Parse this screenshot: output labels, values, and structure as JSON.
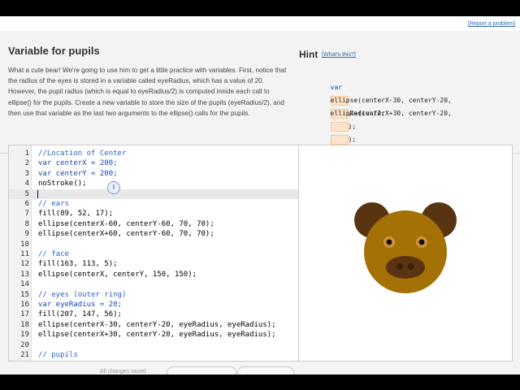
{
  "header": {
    "title": "Variable for pupils",
    "description": "What a cute bear! We're going to use him to get a little practice with variables. First, notice that the radius of the eyes is stored in a variable called eyeRadius, which has a value of 20. However, the pupil radius (which is equal to eyeRadius/2) is computed inside each call to ellipse() for the pupils. Create a new variable to store the size of the pupils (eyeRadius/2), and then use that variable as the last two arguments to the ellipse() calls for the pupils.",
    "report_link": "[Report a problem]"
  },
  "hint": {
    "title": "Hint",
    "whats_this": "[What's this?]",
    "lines": [
      {
        "before": "var",
        "after": "= eyeRadius/2;"
      },
      {
        "before": "ellipse(centerX-30, centerY-20,",
        "middle": ",",
        "after": ");"
      },
      {
        "before": "ellipse(centerX+30, centerY-20,",
        "middle": ",",
        "after": ");"
      }
    ]
  },
  "editor": {
    "current_line": 5,
    "lines": [
      {
        "num": "1",
        "text": "//Location of Center",
        "kind": "comment"
      },
      {
        "num": "2",
        "text": "var centerX = 200;",
        "kind": "var"
      },
      {
        "num": "3",
        "text": "var centerY = 200;",
        "kind": "var"
      },
      {
        "num": "4",
        "text": "noStroke();",
        "kind": "code"
      },
      {
        "num": "5",
        "text": "",
        "kind": "current"
      },
      {
        "num": "6",
        "text": "// ears",
        "kind": "comment"
      },
      {
        "num": "7",
        "text": "fill(89, 52, 17);",
        "kind": "code"
      },
      {
        "num": "8",
        "text": "ellipse(centerX-60, centerY-60, 70, 70);",
        "kind": "code"
      },
      {
        "num": "9",
        "text": "ellipse(centerX+60, centerY-60, 70, 70);",
        "kind": "code"
      },
      {
        "num": "10",
        "text": "",
        "kind": "blank"
      },
      {
        "num": "11",
        "text": "// face",
        "kind": "comment"
      },
      {
        "num": "12",
        "text": "fill(163, 113, 5);",
        "kind": "code"
      },
      {
        "num": "13",
        "text": "ellipse(centerX, centerY, 150, 150);",
        "kind": "code"
      },
      {
        "num": "14",
        "text": "",
        "kind": "blank"
      },
      {
        "num": "15",
        "text": "// eyes (outer ring)",
        "kind": "comment"
      },
      {
        "num": "16",
        "text": "var eyeRadius = 20;",
        "kind": "var"
      },
      {
        "num": "17",
        "text": "fill(207, 147, 56);",
        "kind": "code"
      },
      {
        "num": "18",
        "text": "ellipse(centerX-30, centerY-20, eyeRadius, eyeRadius);",
        "kind": "code"
      },
      {
        "num": "19",
        "text": "ellipse(centerX+30, centerY-20, eyeRadius, eyeRadius);",
        "kind": "code"
      },
      {
        "num": "20",
        "text": "",
        "kind": "blank"
      },
      {
        "num": "21",
        "text": "// pupils",
        "kind": "comment"
      }
    ]
  },
  "canvas": {
    "ear_color": "#593411",
    "face_color": "#a37105",
    "eye_ring_color": "#cf9338",
    "pupil_color": "#111111",
    "muzzle_color": "#5a3410"
  },
  "footer": {
    "saved_text": "All changes saved"
  }
}
